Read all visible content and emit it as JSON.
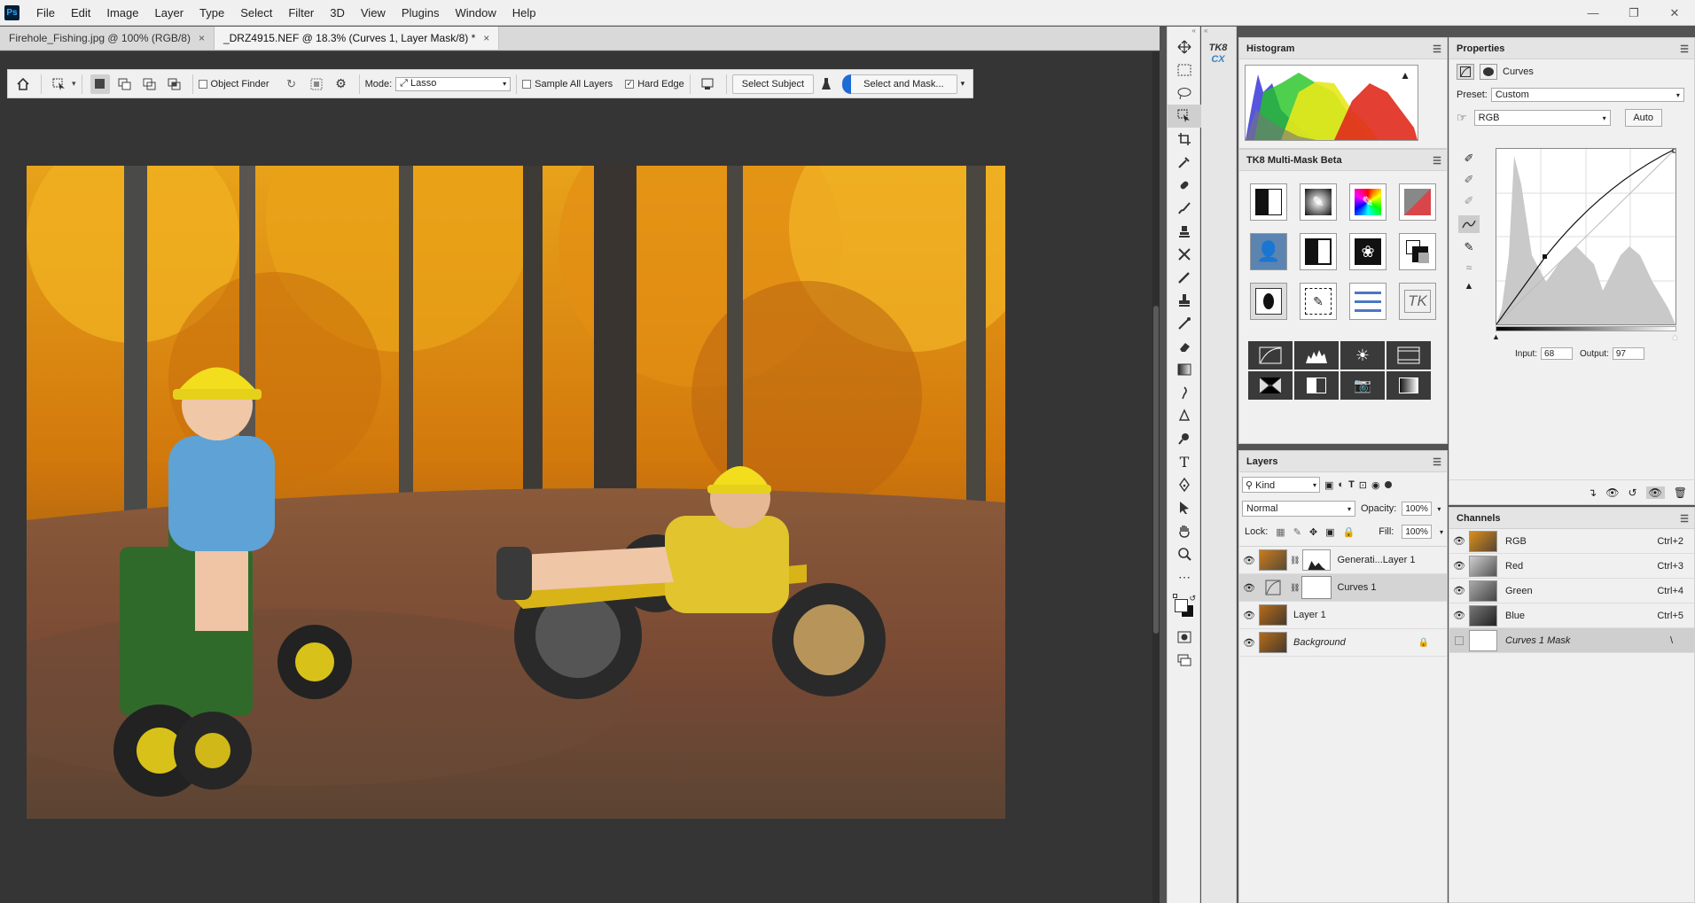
{
  "menubar": {
    "logo": "Ps",
    "items": [
      "File",
      "Edit",
      "Image",
      "Layer",
      "Type",
      "Select",
      "Filter",
      "3D",
      "View",
      "Plugins",
      "Window",
      "Help"
    ]
  },
  "tabs": [
    {
      "label": "Firehole_Fishing.jpg @ 100% (RGB/8)"
    },
    {
      "label": "_DRZ4915.NEF @ 18.3% (Curves 1, Layer Mask/8) *"
    }
  ],
  "options": {
    "object_finder": "Object Finder",
    "mode_label": "Mode:",
    "mode_value": "Lasso",
    "sample_all_layers": "Sample All Layers",
    "hard_edge": "Hard Edge",
    "select_subject": "Select Subject",
    "select_and_mask": "Select and Mask..."
  },
  "tk8_col": {
    "badge_top": "TK8",
    "badge_bottom": "CX"
  },
  "histogram": {
    "title": "Histogram",
    "warning": "▲"
  },
  "multimask": {
    "title": "TK8 Multi-Mask Beta",
    "tk_label": "TK"
  },
  "layers": {
    "title": "Layers",
    "kind": "Kind",
    "blend_mode": "Normal",
    "opacity_label": "Opacity:",
    "opacity_value": "100%",
    "lock_label": "Lock:",
    "fill_label": "Fill:",
    "fill_value": "100%",
    "rows": [
      {
        "name": "Generati...Layer 1"
      },
      {
        "name": "Curves 1"
      },
      {
        "name": "Layer 1"
      },
      {
        "name": "Background"
      }
    ]
  },
  "properties": {
    "title": "Properties",
    "type_label": "Curves",
    "preset_label": "Preset:",
    "preset_value": "Custom",
    "channel_value": "RGB",
    "auto_label": "Auto",
    "input_label": "Input:",
    "input_value": "68",
    "output_label": "Output:",
    "output_value": "97"
  },
  "channels": {
    "title": "Channels",
    "rows": [
      {
        "name": "RGB",
        "shortcut": "Ctrl+2"
      },
      {
        "name": "Red",
        "shortcut": "Ctrl+3"
      },
      {
        "name": "Green",
        "shortcut": "Ctrl+4"
      },
      {
        "name": "Blue",
        "shortcut": "Ctrl+5"
      },
      {
        "name": "Curves 1 Mask",
        "shortcut": "\\"
      }
    ]
  }
}
